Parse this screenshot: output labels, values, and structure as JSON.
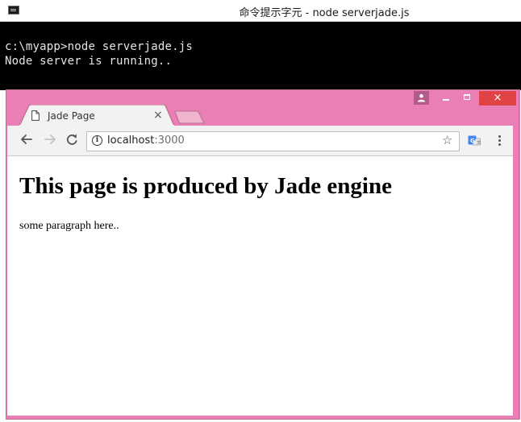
{
  "console": {
    "title": "命令提示字元 - node  serverjade.js",
    "lines": [
      "c:\\myapp>node serverjade.js",
      "Node server is running.."
    ]
  },
  "browser": {
    "tab": {
      "title": "Jade Page",
      "close_glyph": "×"
    },
    "address": {
      "host": "localhost",
      "port": ":3000"
    },
    "window_buttons": {
      "close_glyph": "×"
    },
    "frame_color": "#e97fb4",
    "close_color": "#e04343"
  },
  "page": {
    "heading": "This page is produced by Jade engine",
    "paragraph": "some paragraph here.."
  }
}
